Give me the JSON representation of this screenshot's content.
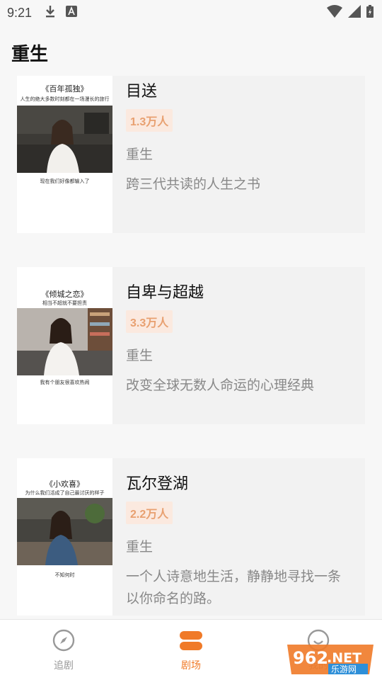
{
  "status_bar": {
    "time": "9:21"
  },
  "header": {
    "title": "重生"
  },
  "items": [
    {
      "cover_title": "《百年孤独》",
      "cover_sub": "人生的绝大多数时刻都在一场漫长的旅行",
      "cover_caption": "现在我们好像都输入了",
      "title": "目送",
      "count": "1.3万人",
      "genre": "重生",
      "desc": "跨三代共读的人生之书"
    },
    {
      "cover_title": "《倾城之恋》",
      "cover_sub": "相当不超就不要担责",
      "cover_caption": "我有个朋友很喜欢热闹",
      "title": "自卑与超越",
      "count": "3.3万人",
      "genre": "重生",
      "desc": "改变全球无数人命运的心理经典"
    },
    {
      "cover_title": "《小欢喜》",
      "cover_sub": "为什么我们活成了自己最讨厌的样子",
      "cover_caption": "不知何时",
      "title": "瓦尔登湖",
      "count": "2.2万人",
      "genre": "重生",
      "desc": "一个人诗意地生活，静静地寻找一条以你命名的路。"
    }
  ],
  "nav": {
    "tab1": "追剧",
    "tab2": "剧场",
    "tab3": "我的"
  },
  "watermark": {
    "number": "962",
    "net": ".NET",
    "site": "乐游网"
  },
  "colors": {
    "accent": "#f07a28",
    "count_bg": "#fbe9df",
    "count_text": "#e8a070"
  }
}
